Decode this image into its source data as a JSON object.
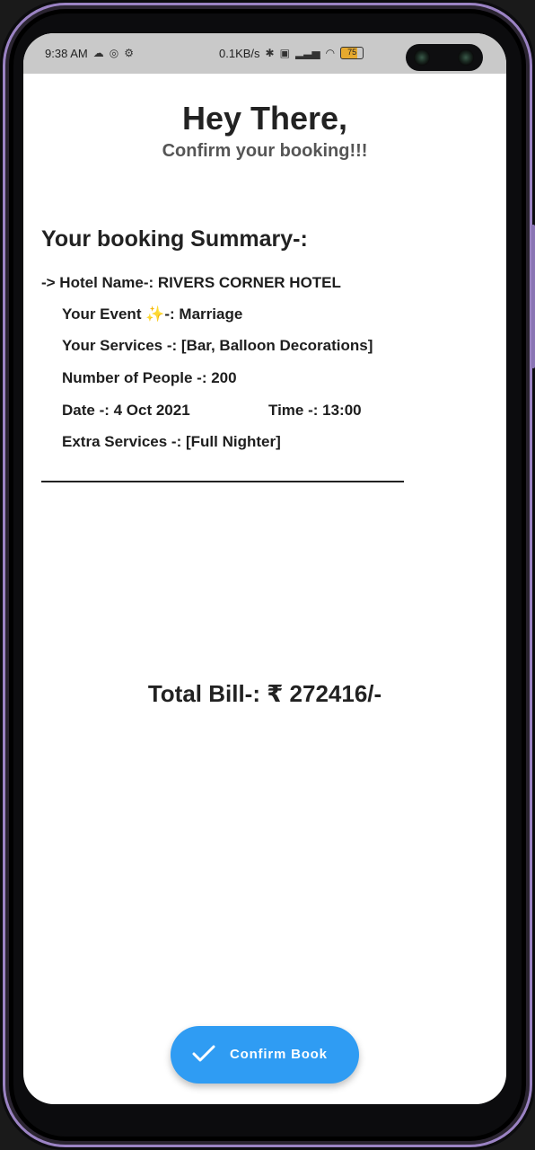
{
  "status_bar": {
    "time": "9:38 AM",
    "network_speed": "0.1KB/s",
    "battery_level": "75"
  },
  "header": {
    "title": "Hey There,",
    "subtitle": "Confirm your booking!!!"
  },
  "summary": {
    "heading": "Your booking Summary-:",
    "hotel": "-> Hotel Name-: RIVERS CORNER HOTEL",
    "event": "Your Event ✨-: Marriage",
    "services": "Your Services -: [Bar, Balloon Decorations]",
    "people": "Number of People -: 200",
    "date": "Date -: 4 Oct 2021",
    "time": "Time -: 13:00",
    "extra": "Extra Services -: [Full Nighter]"
  },
  "total": "Total Bill-: ₹ 272416/-",
  "confirm_button": {
    "label": "Confirm Book",
    "icon": "check-icon"
  },
  "colors": {
    "accent": "#2f9cf3",
    "frame": "#9b83c4"
  }
}
